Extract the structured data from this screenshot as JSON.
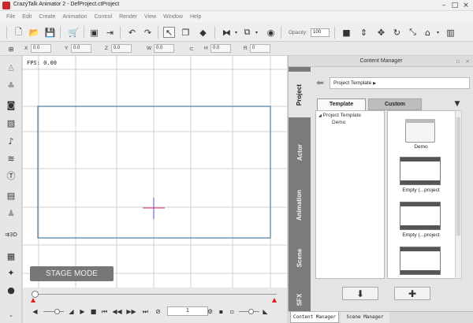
{
  "window": {
    "title": "CrazyTalk Animator 2  - DefProject.ctProject"
  },
  "menu": [
    "File",
    "Edit",
    "Create",
    "Animation",
    "Control",
    "Render",
    "View",
    "Window",
    "Help"
  ],
  "toolbar": {
    "opacity_label": "Opacity:",
    "opacity_value": "100"
  },
  "transform": {
    "x_label": "X",
    "x": "0.0",
    "y_label": "Y",
    "y": "0.0",
    "z_label": "Z",
    "z": "0.0",
    "w_label": "W",
    "w": "0.0",
    "h_label": "H",
    "h": "0.0",
    "r_label": "R",
    "r": "0"
  },
  "stage": {
    "fps": "FPS: 0.00",
    "mode_button": "STAGE MODE"
  },
  "timeline": {
    "frame": "1"
  },
  "content_manager": {
    "title": "Content Manager",
    "vertical_tabs": [
      "Project",
      "Actor",
      "Animation",
      "Scene",
      "SFX"
    ],
    "active_tab": "Project",
    "path": "Project Template",
    "sub_tabs": [
      "Template",
      "Custom"
    ],
    "tree": {
      "root": "Project Template",
      "child": "Demo"
    },
    "items": [
      "Demo",
      "Empty (...project",
      "Empty (...project"
    ]
  },
  "bottom_tabs": [
    "Content Manager",
    "Scene Manager"
  ],
  "colors": {
    "stage_frame": "#4a7ca0",
    "crosshair_h": "#e03070",
    "crosshair_v": "#5050e0",
    "timeline_marker": "#e02020"
  }
}
